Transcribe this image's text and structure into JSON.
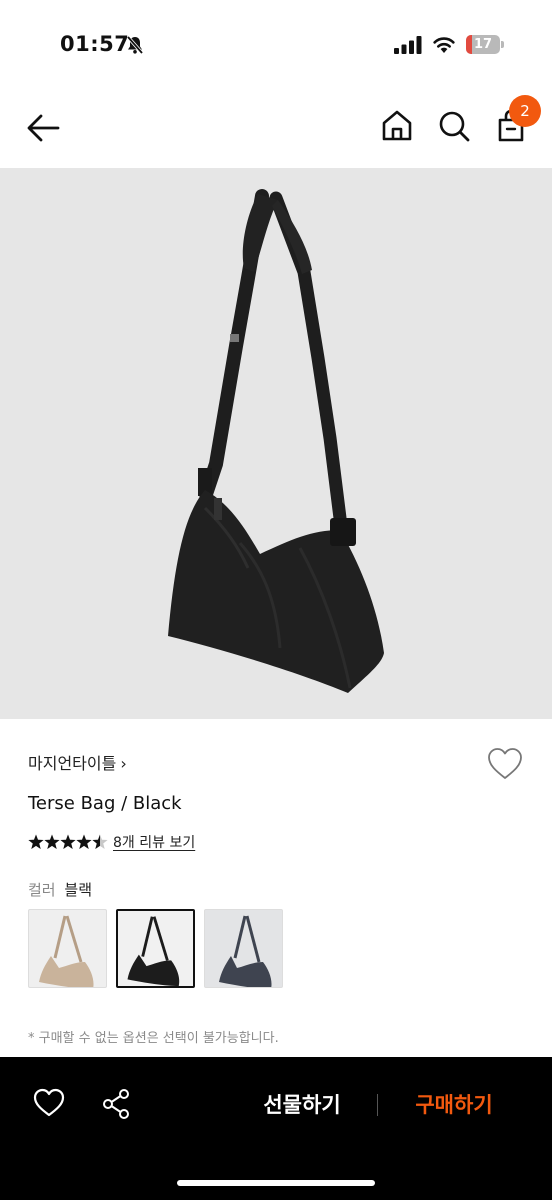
{
  "status_bar": {
    "time": "01:57",
    "battery_level": "17",
    "battery_fraction": 0.17,
    "icons": [
      "bell-slash-icon",
      "signal-icon",
      "wifi-icon",
      "battery-icon"
    ]
  },
  "nav": {
    "icons": [
      "back-arrow-icon",
      "home-icon",
      "search-icon",
      "cart-icon"
    ],
    "cart_count": "2"
  },
  "product": {
    "brand": "마지언타이틀",
    "brand_chevron": "›",
    "name": "Terse Bag / Black",
    "rating": 4.5,
    "rating_max": 5,
    "review_link": "8개 리뷰 보기",
    "color_label": "컬러",
    "color_value": "블랙",
    "swatches": [
      {
        "name": "beige",
        "color": "#c9b39b",
        "selected": false
      },
      {
        "name": "black",
        "color": "#1c1c1c",
        "selected": true
      },
      {
        "name": "gray",
        "color": "#3f4450",
        "selected": false
      }
    ],
    "notice": "* 구매할 수 없는 옵션은 선택이 불가능합니다."
  },
  "bottom_bar": {
    "gift_label": "선물하기",
    "buy_label": "구매하기",
    "icons": [
      "heart-icon",
      "share-icon"
    ]
  },
  "colors": {
    "accent": "#f2590f",
    "bottom_bar_bg": "#000000",
    "image_bg": "#e6e6e6"
  }
}
